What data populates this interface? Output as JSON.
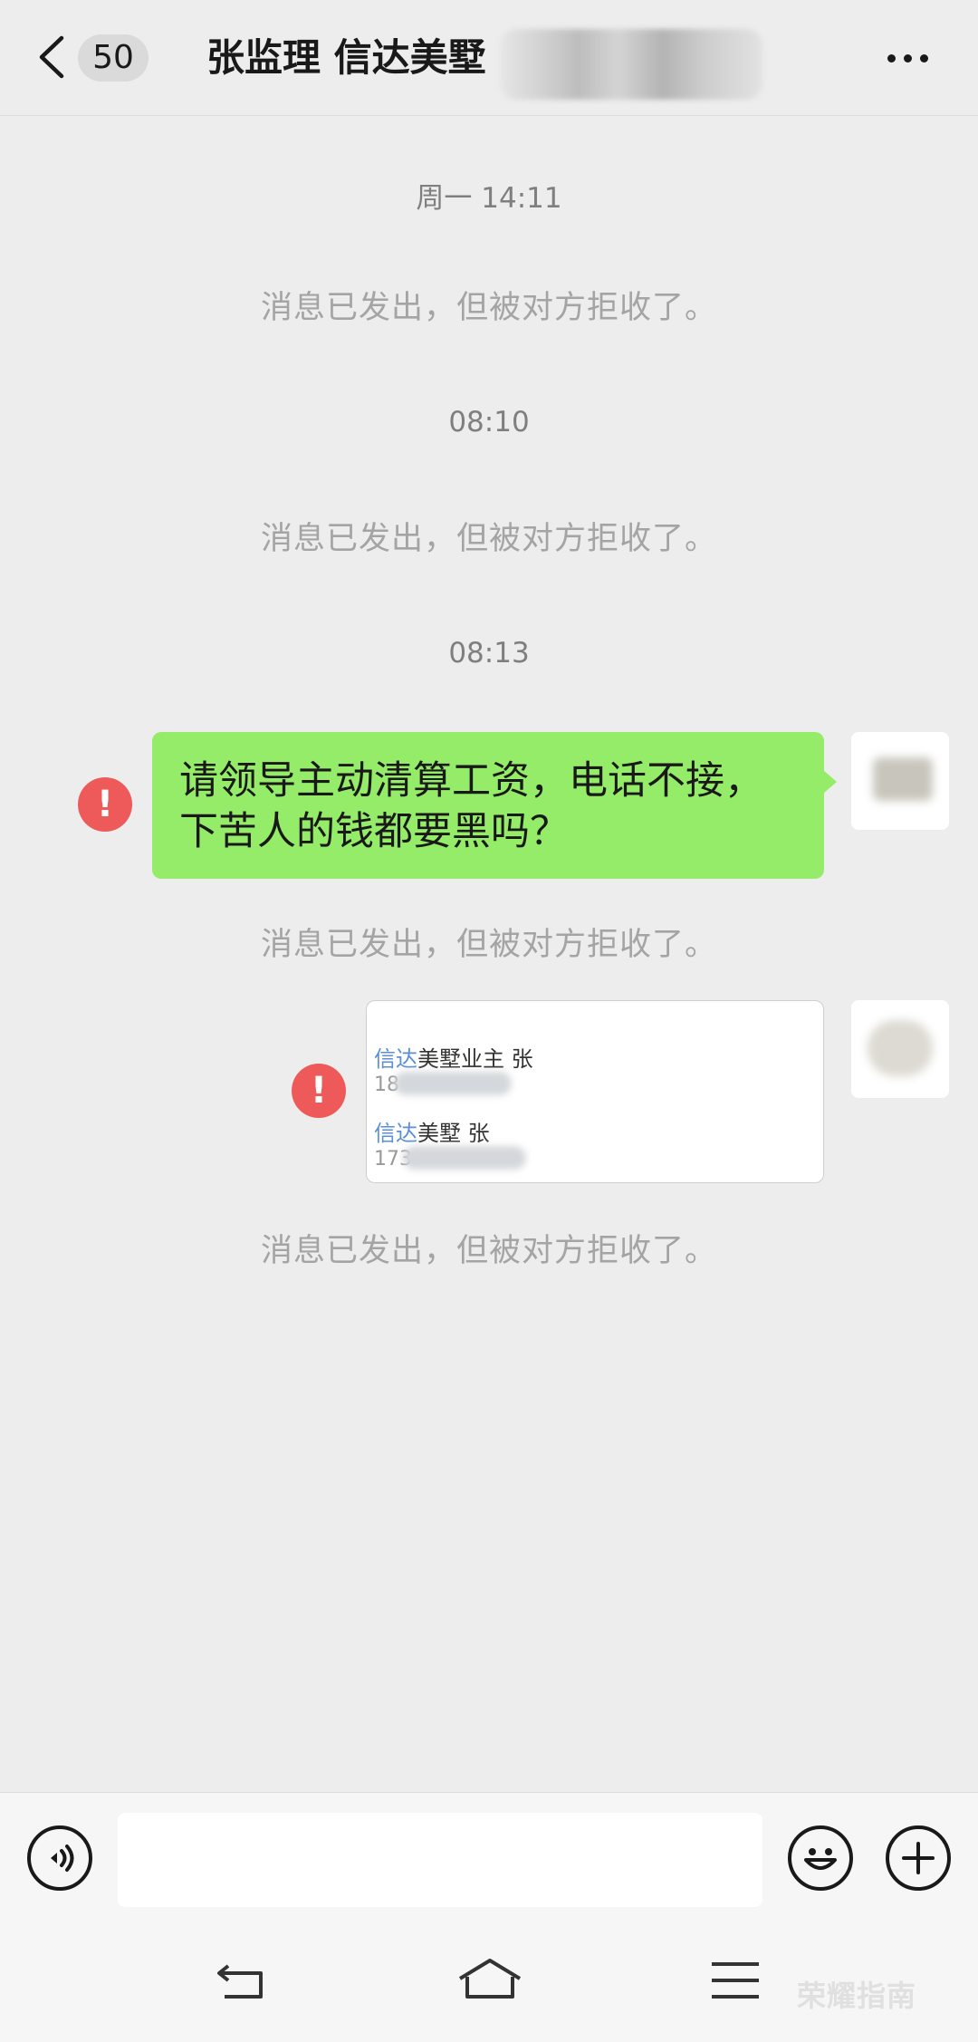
{
  "header": {
    "unread_count": "50",
    "title": "张监理 信达美墅"
  },
  "messages": {
    "time1": "周一 14:11",
    "system1": "消息已发出，但被对方拒收了。",
    "time2": "08:10",
    "system2": "消息已发出，但被对方拒收了。",
    "time3": "08:13",
    "text_bubble_line1": "请领导主动清算工资，电话不接，",
    "text_bubble_line2": "下苦人的钱都要黑吗？",
    "error_mark": "!",
    "system3": "消息已发出，但被对方拒收了。",
    "image_contact1_hl": "信达",
    "image_contact1_rest": "美墅业主 张",
    "image_contact1_phone": "18",
    "image_contact2_hl": "信达",
    "image_contact2_rest": "美墅 张",
    "image_contact2_phone": "173",
    "system4": "消息已发出，但被对方拒收了。"
  },
  "input": {
    "value": ""
  },
  "icons": {
    "back": "chevron-left-icon",
    "more": "more-dots-icon",
    "voice": "voice-icon",
    "emoji": "emoji-icon",
    "plus": "plus-icon"
  },
  "watermark": "荣耀指南"
}
